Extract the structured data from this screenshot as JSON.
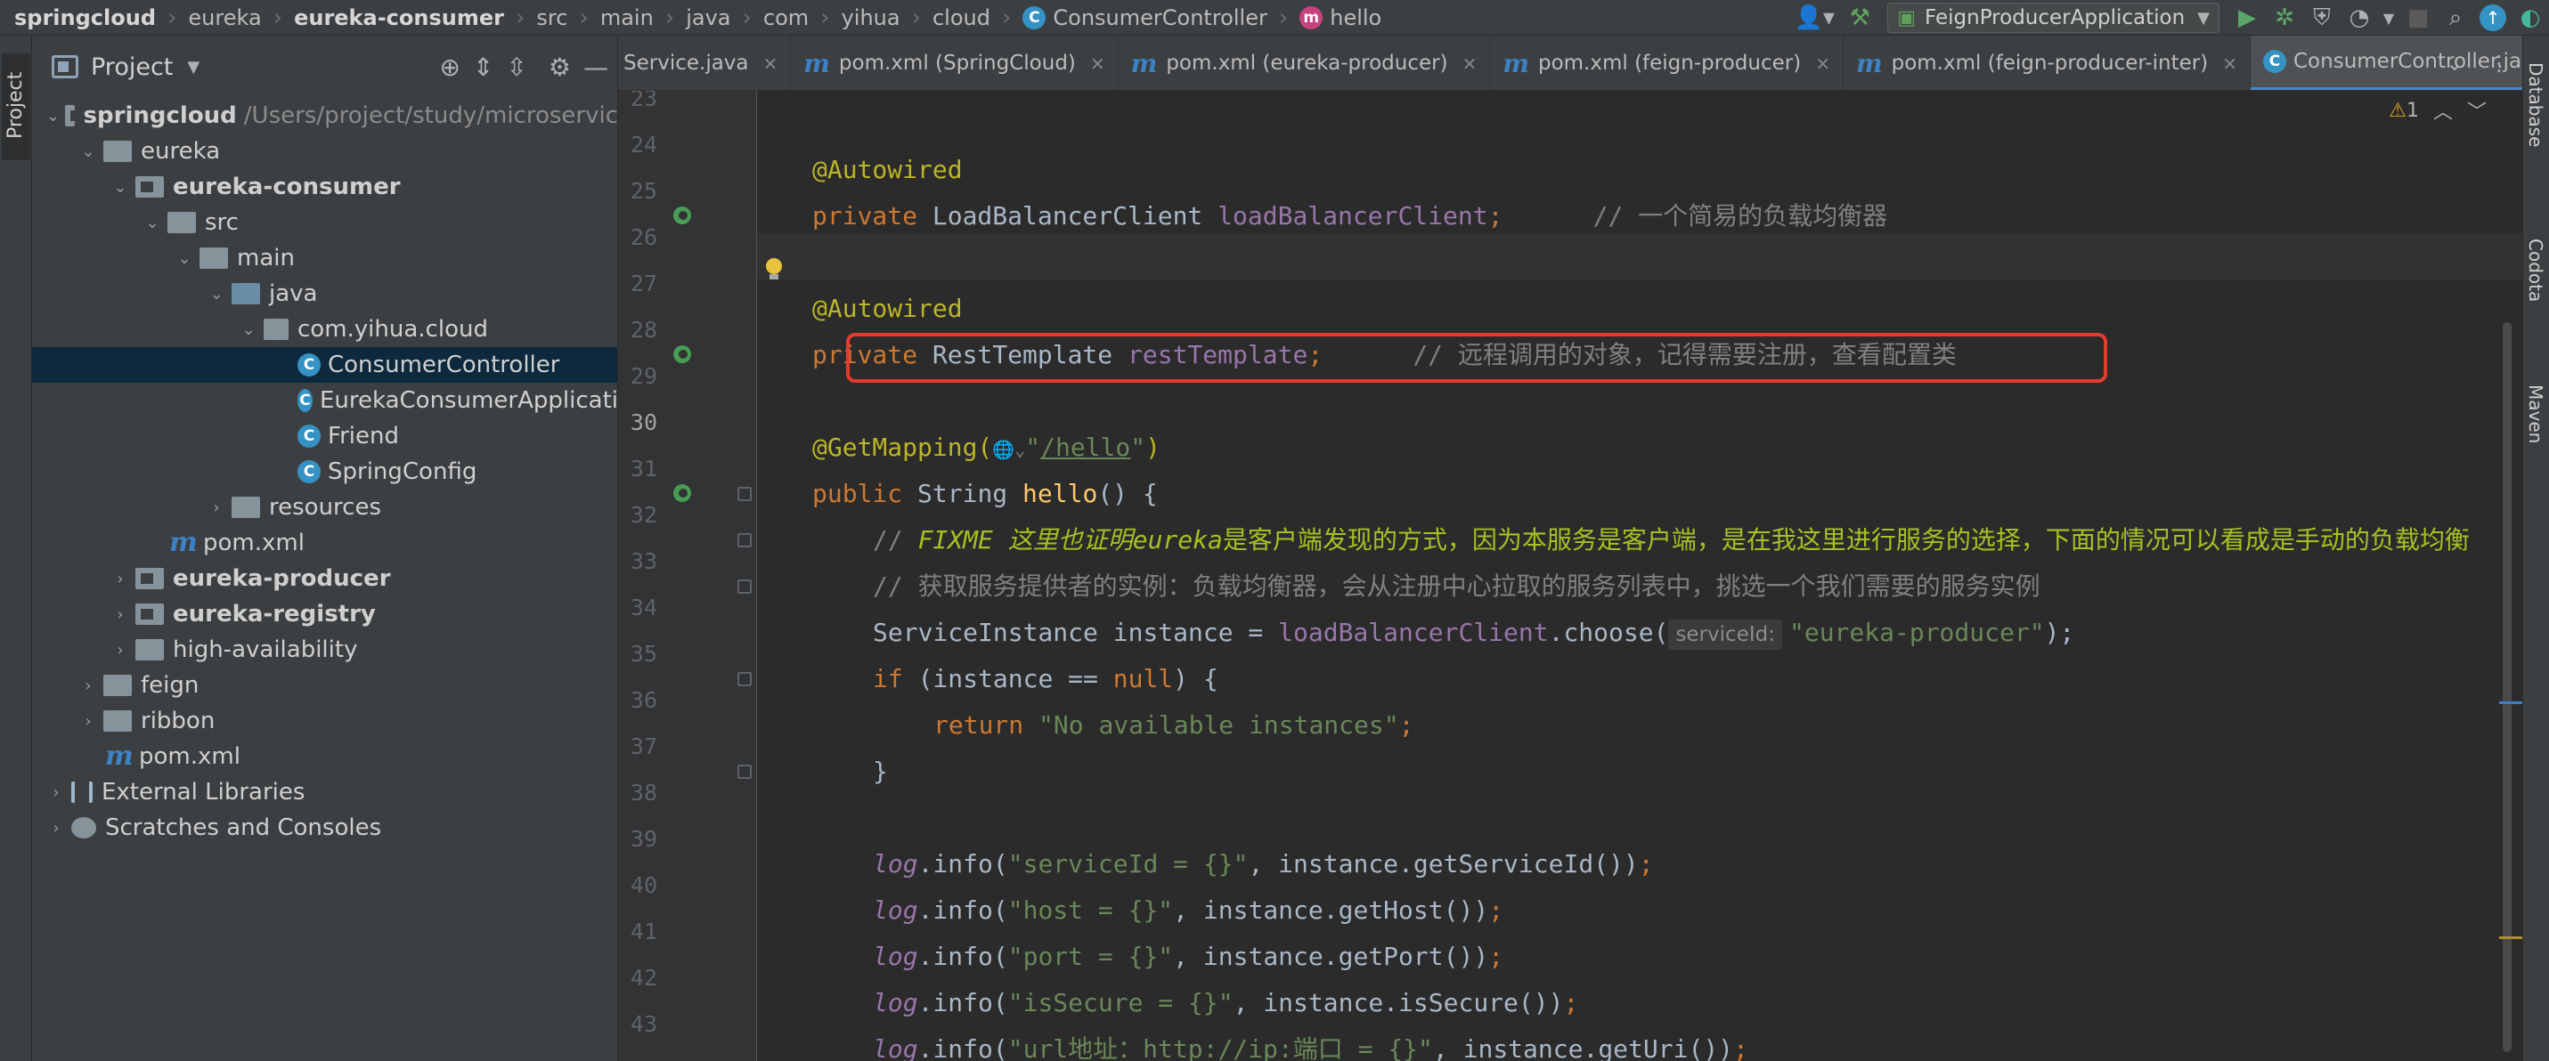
{
  "breadcrumb": {
    "items": [
      "springcloud",
      "eureka",
      "eureka-consumer",
      "src",
      "main",
      "java",
      "com",
      "yihua",
      "cloud"
    ],
    "class_name": "ConsumerController",
    "method_name": "hello"
  },
  "toolbar": {
    "run_config": "FeignProducerApplication"
  },
  "side_strips": {
    "left": "Project",
    "right": [
      "Database",
      "Codota",
      "Maven"
    ]
  },
  "project": {
    "title": "Project",
    "tree": [
      {
        "label": "springcloud",
        "path": "/Users/project/study/microservic"
      },
      {
        "label": "eureka"
      },
      {
        "label": "eureka-consumer"
      },
      {
        "label": "src"
      },
      {
        "label": "main"
      },
      {
        "label": "java"
      },
      {
        "label": "com.yihua.cloud"
      },
      {
        "label": "ConsumerController"
      },
      {
        "label": "EurekaConsumerApplicati"
      },
      {
        "label": "Friend"
      },
      {
        "label": "SpringConfig"
      },
      {
        "label": "resources"
      },
      {
        "label": "pom.xml"
      },
      {
        "label": "eureka-producer"
      },
      {
        "label": "eureka-registry"
      },
      {
        "label": "high-availability"
      },
      {
        "label": "feign"
      },
      {
        "label": "ribbon"
      },
      {
        "label": "pom.xml"
      },
      {
        "label": "External Libraries"
      },
      {
        "label": "Scratches and Consoles"
      }
    ]
  },
  "tabs": [
    {
      "label": "Service.java"
    },
    {
      "label": "pom.xml (SpringCloud)"
    },
    {
      "label": "pom.xml (eureka-producer)"
    },
    {
      "label": "pom.xml (feign-producer)"
    },
    {
      "label": "pom.xml (feign-producer-inter)"
    },
    {
      "label": "ConsumerController.java"
    }
  ],
  "editor": {
    "warning_count": "1",
    "line_numbers": [
      "23",
      "24",
      "25",
      "26",
      "27",
      "28",
      "29",
      "30",
      "31",
      "32",
      "33",
      "34",
      "35",
      "36",
      "37",
      "38",
      "39",
      "40",
      "41",
      "42",
      "43"
    ],
    "code": {
      "l24_ann": "@Autowired",
      "l25_kw": "private ",
      "l25_type": "LoadBalancerClient ",
      "l25_field": "loadBalancerClient",
      "l25_semi": ";",
      "l25_comment": "      // 一个简易的负载均衡器",
      "l27_ann": "@Autowired",
      "l28_kw": "private ",
      "l28_type": "RestTemplate ",
      "l28_field": "restTemplate",
      "l28_semi": ";",
      "l28_comment": "      // 远程调用的对象，记得需要注册，查看配置类",
      "l30_ann": "@GetMapping(",
      "l30_icon": "🌐⌄",
      "l30_q1": "\"",
      "l30_path": "/hello",
      "l30_q2": "\"",
      "l30_end": ")",
      "l31_kw": "public ",
      "l31_type": "String ",
      "l31_fn": "hello",
      "l31_rest": "() {",
      "l32_cm": "// ",
      "l32_todo": "FIXME 这里也证明",
      "l32_todo2": "eureka",
      "l32_todo3": "是客户端发现的方式，因为本服务是客户端，是在我这里进行服务的选择，下面的情况可以看成是手动的负载均衡",
      "l33_cm": "// 获取服务提供者的实例：负载均衡器，会从注册中心拉取的服务列表中，挑选一个我们需要的服务实例",
      "l34_a": "ServiceInstance instance = ",
      "l34_field": "loadBalancerClient",
      "l34_b": ".choose(",
      "l34_hint": "serviceId:",
      "l34_str": "\"eureka-producer\"",
      "l34_end": ");",
      "l35_kw": "if ",
      "l35_a": "(instance == ",
      "l35_null": "null",
      "l35_b": ") {",
      "l36_kw": "return ",
      "l36_str": "\"No available instances\"",
      "l36_semi": ";",
      "l37": "}",
      "l39_log": "log",
      "l39_a": ".info(",
      "l39_str": "\"serviceId = {}\"",
      "l39_b": ", instance.getServiceId())",
      "l39_semi": ";",
      "l40_log": "log",
      "l40_a": ".info(",
      "l40_str": "\"host = {}\"",
      "l40_b": ", instance.getHost())",
      "l40_semi": ";",
      "l41_log": "log",
      "l41_a": ".info(",
      "l41_str": "\"port = {}\"",
      "l41_b": ", instance.getPort())",
      "l41_semi": ";",
      "l42_log": "log",
      "l42_a": ".info(",
      "l42_str": "\"isSecure = {}\"",
      "l42_b": ", instance.isSecure())",
      "l42_semi": ";",
      "l43_log": "log",
      "l43_a": ".info(",
      "l43_str": "\"url地址：http://ip:端口 = {}\"",
      "l43_b": ", instance.getUri())",
      "l43_semi": ";"
    }
  },
  "colors": {
    "highlight_box": "#e33b2e",
    "active_tab_underline": "#4a88c7",
    "selection": "#0d293e"
  }
}
